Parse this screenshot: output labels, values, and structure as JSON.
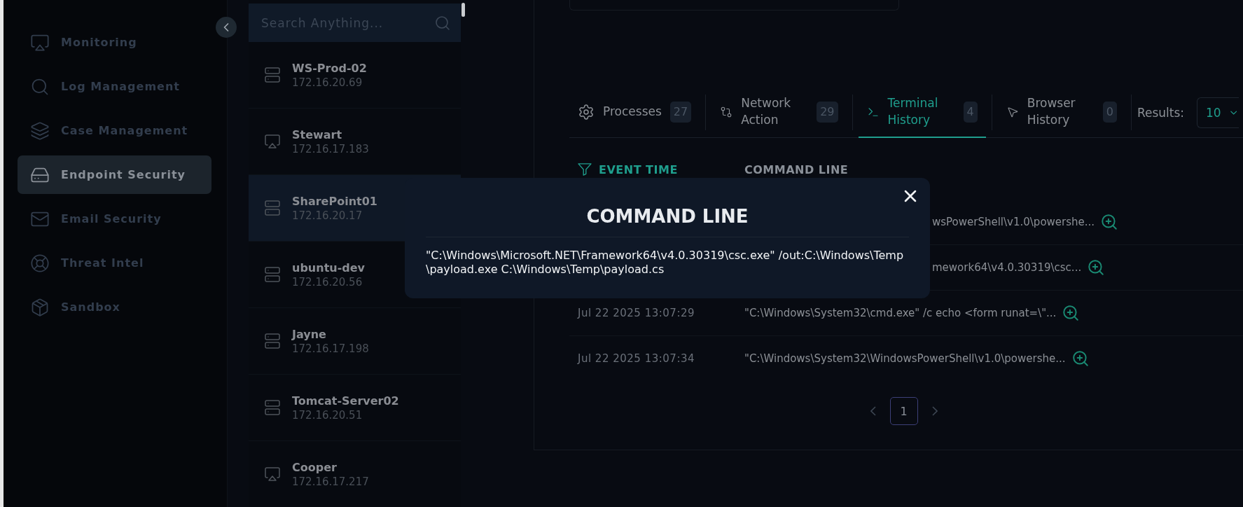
{
  "sidebar": {
    "items": [
      {
        "label": "Monitoring",
        "selected": false
      },
      {
        "label": "Log Management",
        "selected": false
      },
      {
        "label": "Case Management",
        "selected": false
      },
      {
        "label": "Endpoint Security",
        "selected": true
      },
      {
        "label": "Email Security",
        "selected": false
      },
      {
        "label": "Threat Intel",
        "selected": false
      },
      {
        "label": "Sandbox",
        "selected": false
      }
    ]
  },
  "hosts": {
    "search": {
      "placeholder": "Search Anything..."
    },
    "items": [
      {
        "name": "WS-Prod-02",
        "ip": "172.16.20.69",
        "kind": "server",
        "selected": false
      },
      {
        "name": "Stewart",
        "ip": "172.16.17.183",
        "kind": "desktop",
        "selected": false
      },
      {
        "name": "SharePoint01",
        "ip": "172.16.20.17",
        "kind": "server",
        "selected": true
      },
      {
        "name": "ubuntu-dev",
        "ip": "172.16.20.56",
        "kind": "server",
        "selected": false
      },
      {
        "name": "Jayne",
        "ip": "172.16.17.198",
        "kind": "server",
        "selected": false
      },
      {
        "name": "Tomcat-Server02",
        "ip": "172.16.20.51",
        "kind": "server",
        "selected": false
      },
      {
        "name": "Cooper",
        "ip": "172.16.17.217",
        "kind": "desktop",
        "selected": false
      }
    ]
  },
  "tabs": [
    {
      "label": "Processes",
      "count": "27",
      "selected": false
    },
    {
      "label": "Network Action",
      "count": "29",
      "selected": false
    },
    {
      "label": "Terminal History",
      "count": "4",
      "selected": true
    },
    {
      "label": "Browser History",
      "count": "0",
      "selected": false
    }
  ],
  "results": {
    "label": "Results:",
    "value": "10"
  },
  "table": {
    "columns": [
      {
        "label": "EVENT TIME",
        "sorted": true
      },
      {
        "label": "COMMAND LINE",
        "sorted": false
      }
    ],
    "rows": [
      {
        "command_line": "wsPowerShell\\v1.0\\powershe..."
      },
      {
        "command_line": "mework64\\v4.0.30319\\csc..."
      },
      {
        "event_time": "Jul 22 2025 13:07:29",
        "command_line": "\"C:\\Windows\\System32\\cmd.exe\" /c echo <form runat=\\\"..."
      },
      {
        "event_time": "Jul 22 2025 13:07:34",
        "command_line": "\"C:\\Windows\\System32\\WindowsPowerShell\\v1.0\\powershe..."
      }
    ]
  },
  "pagination": {
    "pages": [
      {
        "label": "1",
        "selected": true
      }
    ]
  },
  "modal": {
    "title": "COMMAND LINE",
    "body": "\"C:\\Windows\\Microsoft.NET\\Framework64\\v4.0.30319\\csc.exe\" /out:C:\\Windows\\Temp\\payload.exe C:\\Windows\\Temp\\payload.cs"
  }
}
